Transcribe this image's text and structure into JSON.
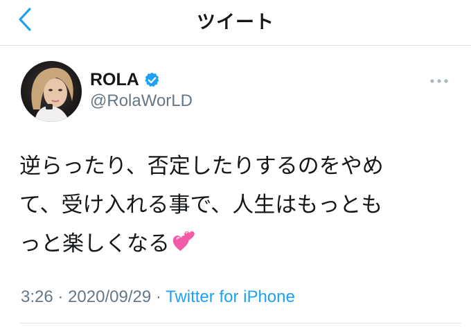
{
  "header": {
    "title": "ツイート",
    "back_icon": "chevron-left-icon"
  },
  "tweet": {
    "display_name": "ROLA",
    "verified": true,
    "handle": "@RolaWorLD",
    "text_lines": [
      "逆らったり、否定したりするのをやめ",
      "て、受け入れる事で、人生はもっとも",
      "っと楽しくなる"
    ],
    "emoji": "two-hearts-icon",
    "time": "3:26",
    "separator": "·",
    "date": "2020/09/29",
    "source": "Twitter for iPhone"
  },
  "colors": {
    "accent": "#1da1f2",
    "text_primary": "#14171a",
    "text_secondary": "#657786",
    "divider": "#dfe3e6",
    "heart_pink": "#f45ba6"
  }
}
